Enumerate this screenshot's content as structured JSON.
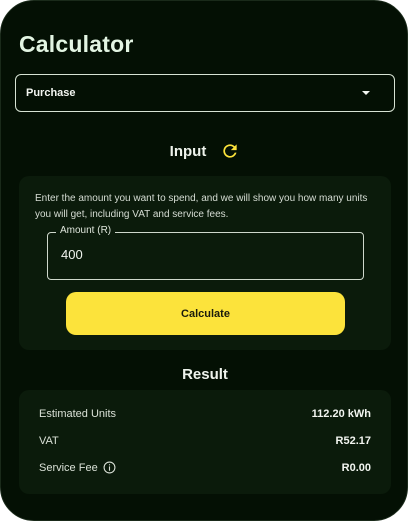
{
  "header": {
    "title": "Calculator"
  },
  "mode_select": {
    "value": "Purchase"
  },
  "input_section": {
    "heading": "Input",
    "description": "Enter the amount you want to spend, and we will show you how many units you will get, including VAT and service fees.",
    "amount_label": "Amount (R)",
    "amount_value": "400",
    "calculate_label": "Calculate"
  },
  "result_section": {
    "heading": "Result",
    "rows": [
      {
        "label": "Estimated Units",
        "value": "112.20 kWh"
      },
      {
        "label": "VAT",
        "value": "R52.17"
      },
      {
        "label": "Service Fee",
        "value": "R0.00"
      }
    ]
  },
  "colors": {
    "background": "#041004",
    "card": "#0b1b0b",
    "accent": "#fce33b",
    "text": "#eef3ec"
  },
  "icons": {
    "refresh": "refresh-icon",
    "dropdown": "chevron-down-icon",
    "info": "info-icon"
  }
}
